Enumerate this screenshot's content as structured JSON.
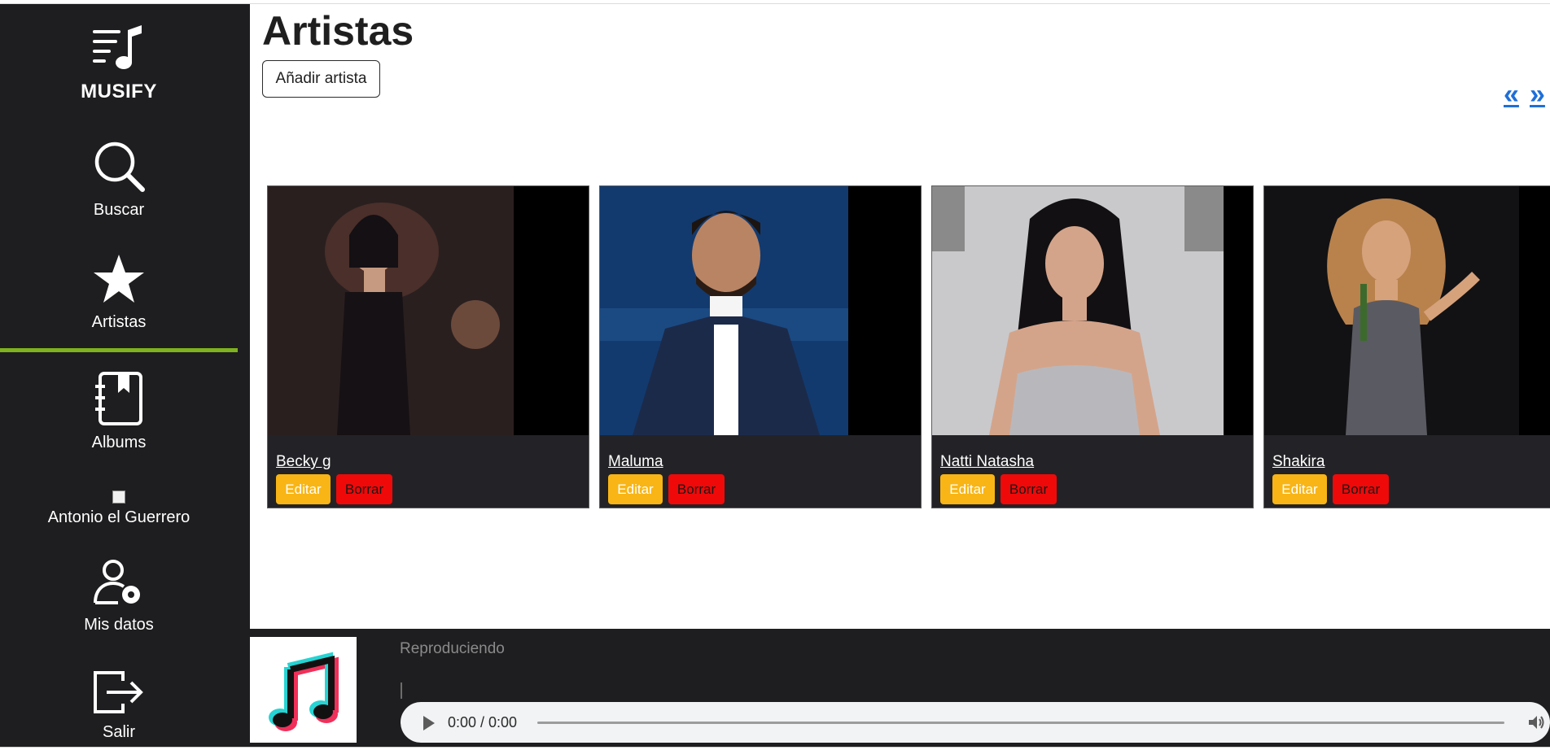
{
  "app": {
    "brand": "MUSIFY"
  },
  "sidebar": {
    "items": [
      {
        "label": "Buscar",
        "icon": "search-icon"
      },
      {
        "label": "Artistas",
        "icon": "star-icon",
        "active": true
      },
      {
        "label": "Albums",
        "icon": "album-book-icon"
      },
      {
        "label": "Antonio el Guerrero",
        "icon": "broken-image-icon"
      },
      {
        "label": "Mis datos",
        "icon": "user-settings-icon"
      },
      {
        "label": "Salir",
        "icon": "logout-icon"
      }
    ],
    "accent_color": "#7fb21f"
  },
  "main": {
    "title": "Artistas",
    "add_button": "Añadir artista",
    "pager": {
      "prev": "«",
      "next": "»"
    },
    "artists": [
      {
        "name": "Becky g",
        "edit": "Editar",
        "delete": "Borrar"
      },
      {
        "name": "Maluma",
        "edit": "Editar",
        "delete": "Borrar"
      },
      {
        "name": "Natti Natasha",
        "edit": "Editar",
        "delete": "Borrar"
      },
      {
        "name": "Shakira",
        "edit": "Editar",
        "delete": "Borrar"
      }
    ]
  },
  "player": {
    "status": "Reproduciendo",
    "time": "0:00 / 0:00",
    "cover_icon": "music-note-icon"
  },
  "colors": {
    "edit_button": "#f8b515",
    "delete_button": "#f00909",
    "sidebar_bg": "#1e1e20",
    "link_blue": "#1f6fd8"
  }
}
